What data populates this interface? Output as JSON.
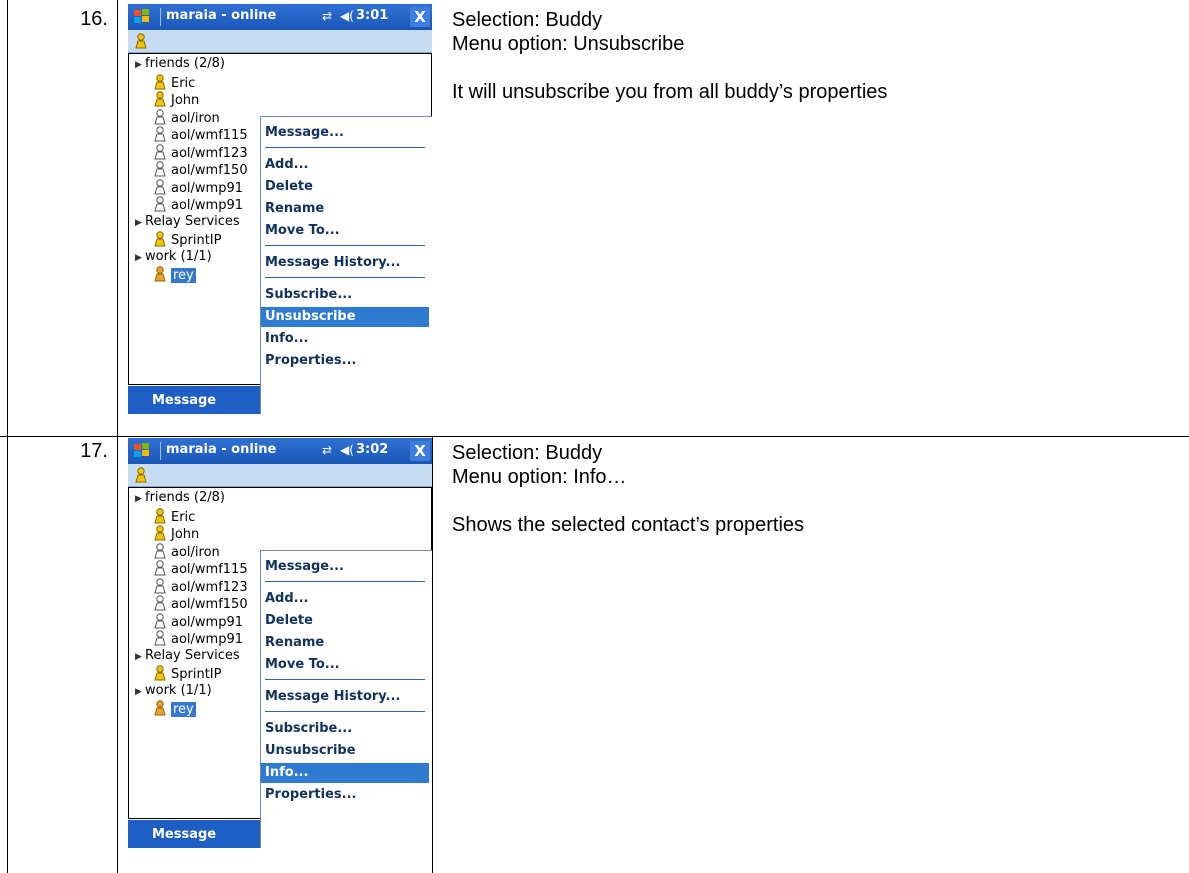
{
  "rows": [
    {
      "number": "16.",
      "phone": {
        "title": "maraia - online",
        "time": "3:01",
        "close": "X",
        "tree": [
          {
            "type": "group",
            "label": "friends (2/8)"
          },
          {
            "type": "online",
            "label": "Eric"
          },
          {
            "type": "online",
            "label": "John"
          },
          {
            "type": "offline",
            "label": "aol/iron"
          },
          {
            "type": "offline",
            "label": "aol/wmf115"
          },
          {
            "type": "offline",
            "label": "aol/wmf123"
          },
          {
            "type": "offline",
            "label": "aol/wmf150"
          },
          {
            "type": "offline",
            "label": "aol/wmp91"
          },
          {
            "type": "offline",
            "label": "aol/wmp91"
          },
          {
            "type": "group",
            "label": "Relay Services"
          },
          {
            "type": "online",
            "label": "SprintIP"
          },
          {
            "type": "group",
            "label": "work (1/1)"
          },
          {
            "type": "selected",
            "label": "rey"
          }
        ],
        "menu": [
          "Message...",
          "Add...",
          "Delete",
          "Rename",
          "Move To...",
          "Message History...",
          "Subscribe...",
          "Unsubscribe",
          "Info...",
          "Properties..."
        ],
        "highlighted": "Unsubscribe",
        "bottom_label": "Message"
      },
      "selection": "Selection: Buddy",
      "menu_option": "Menu option: Unsubscribe",
      "description": "It will unsubscribe you from all buddy’s properties"
    },
    {
      "number": "17.",
      "phone": {
        "title": "maraia - online",
        "time": "3:02",
        "close": "X",
        "tree": [
          {
            "type": "group",
            "label": "friends (2/8)"
          },
          {
            "type": "online",
            "label": "Eric"
          },
          {
            "type": "online",
            "label": "John"
          },
          {
            "type": "offline",
            "label": "aol/iron"
          },
          {
            "type": "offline",
            "label": "aol/wmf115"
          },
          {
            "type": "offline",
            "label": "aol/wmf123"
          },
          {
            "type": "offline",
            "label": "aol/wmf150"
          },
          {
            "type": "offline",
            "label": "aol/wmp91"
          },
          {
            "type": "offline",
            "label": "aol/wmp91"
          },
          {
            "type": "group",
            "label": "Relay Services"
          },
          {
            "type": "online",
            "label": "SprintIP"
          },
          {
            "type": "group",
            "label": "work (1/1)"
          },
          {
            "type": "selected",
            "label": "rey"
          }
        ],
        "menu": [
          "Message...",
          "Add...",
          "Delete",
          "Rename",
          "Move To...",
          "Message History...",
          "Subscribe...",
          "Unsubscribe",
          "Info...",
          "Properties..."
        ],
        "highlighted": "Info...",
        "bottom_label": "Message"
      },
      "selection": "Selection: Buddy",
      "menu_option": "Menu option: Info…",
      "description": "Shows the selected contact’s properties"
    }
  ]
}
